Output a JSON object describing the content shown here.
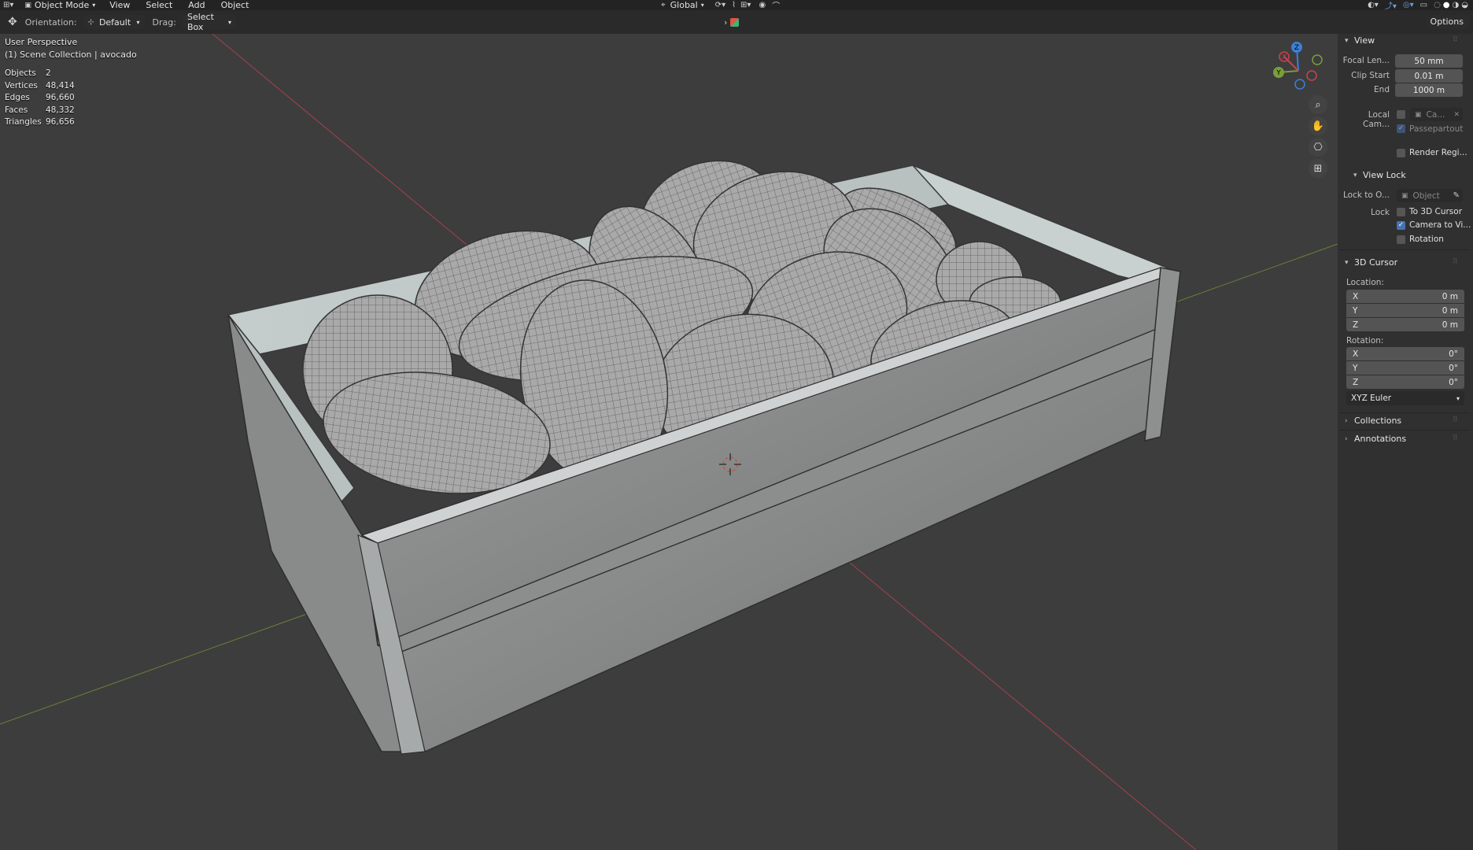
{
  "header": {
    "mode": "Object Mode",
    "menus": [
      "View",
      "Select",
      "Add",
      "Object"
    ],
    "transform_orientation": "Global"
  },
  "tool_header": {
    "orientation_label": "Orientation:",
    "orientation_value": "Default",
    "drag_label": "Drag:",
    "drag_value": "Select Box",
    "options": "Options"
  },
  "viewport": {
    "perspective": "User Perspective",
    "collection": "(1) Scene Collection | avocado",
    "stats": [
      {
        "key": "Objects",
        "value": "2"
      },
      {
        "key": "Vertices",
        "value": "48,414"
      },
      {
        "key": "Edges",
        "value": "96,660"
      },
      {
        "key": "Faces",
        "value": "48,332"
      },
      {
        "key": "Triangles",
        "value": "96,656"
      }
    ],
    "gizmo": {
      "x": "X",
      "y": "Y",
      "z": "Z"
    }
  },
  "sidebar": {
    "view_title": "View",
    "focal_label": "Focal Len...",
    "focal_value": "50 mm",
    "clip_start_label": "Clip Start",
    "clip_start_value": "0.01 m",
    "end_label": "End",
    "end_value": "1000 m",
    "local_cam_label": "Local Cam...",
    "local_cam_value": "Ca...",
    "passepartout": "Passepartout",
    "render_region": "Render Regi...",
    "view_lock_title": "View Lock",
    "lock_to_label": "Lock to O...",
    "lock_to_placeholder": "Object",
    "lock_label": "Lock",
    "to_3d_cursor": "To 3D Cursor",
    "camera_to_view": "Camera to Vi...",
    "rotation_cb": "Rotation",
    "cursor_title": "3D Cursor",
    "location_label": "Location:",
    "location": [
      {
        "axis": "X",
        "value": "0 m"
      },
      {
        "axis": "Y",
        "value": "0 m"
      },
      {
        "axis": "Z",
        "value": "0 m"
      }
    ],
    "rotation_label": "Rotation:",
    "rotation": [
      {
        "axis": "X",
        "value": "0°"
      },
      {
        "axis": "Y",
        "value": "0°"
      },
      {
        "axis": "Z",
        "value": "0°"
      }
    ],
    "rotation_mode": "XYZ Euler",
    "collections": "Collections",
    "annotations": "Annotations"
  },
  "colors": {
    "background": "#3d3d3d",
    "panel": "#303030",
    "accent": "#4772b3",
    "axis_x": "#c8434e",
    "axis_y": "#7a9e39",
    "axis_z": "#3d7fd4"
  }
}
